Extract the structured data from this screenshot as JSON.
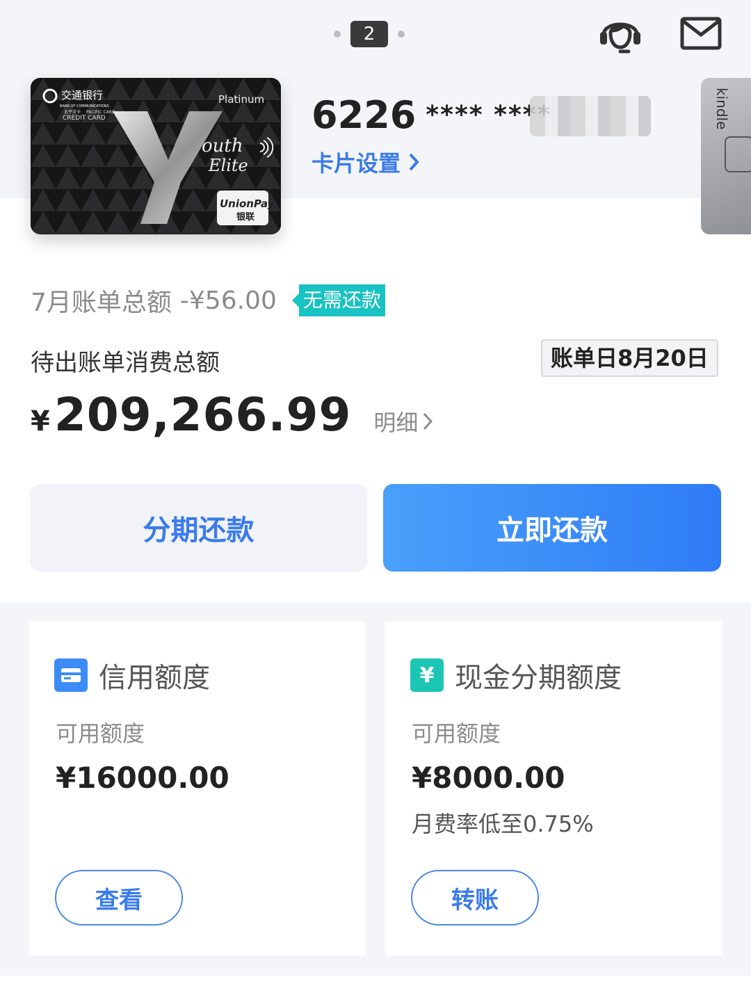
{
  "header": {
    "page_indicator": "2",
    "icons": [
      "headset-icon",
      "mail-icon"
    ]
  },
  "card": {
    "bank_cn": "交通银行",
    "bank_en": "BANK OF COMMUNICATIONS",
    "card_brand_cn": "太平洋卡",
    "card_brand_en": "PACIFIC CARD",
    "card_type": "CREDIT CARD",
    "tier": "Platinum",
    "product_line1": "outh",
    "product_line2": "Elite",
    "network": "UnionPay",
    "network_cn": "银联",
    "side_card_label": "kindle",
    "number_prefix": "6226",
    "number_mask": "**** ****",
    "settings_label": "卡片设置"
  },
  "bill": {
    "label": "7月账单总额",
    "amount": "-¥56.00",
    "status_tag": "无需还款",
    "pending_label": "待出账单消费总额",
    "bill_date": "账单日8月20日",
    "currency": "¥",
    "pending_total": "209,266.99",
    "detail_label": "明细"
  },
  "actions": {
    "installment": "分期还款",
    "repay_now": "立即还款"
  },
  "credit_limit": {
    "title": "信用额度",
    "sub": "可用额度",
    "amount": "¥16000.00",
    "button": "查看"
  },
  "cash_installment": {
    "title": "现金分期额度",
    "icon_glyph": "¥",
    "sub": "可用额度",
    "amount": "¥8000.00",
    "rate_note": "月费率低至0.75%",
    "button": "转账"
  },
  "colors": {
    "accent_blue": "#3a7bea",
    "teal_tag": "#19c2c3",
    "background_gray": "#f4f5f8"
  }
}
